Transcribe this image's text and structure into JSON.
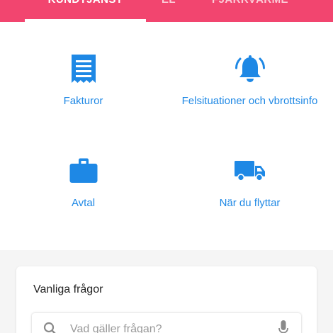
{
  "tabs": [
    {
      "label": "KUNDTJÄNST",
      "active": true
    },
    {
      "label": "EL",
      "active": false
    },
    {
      "label": "FJÄRRVÄRME",
      "active": false
    }
  ],
  "tiles": [
    {
      "label": "Fakturor",
      "icon": "receipt-icon"
    },
    {
      "label": "Felsituationer och vbrottsinfo",
      "icon": "bell-icon"
    },
    {
      "label": "Avtal",
      "icon": "briefcase-icon"
    },
    {
      "label": "När du flyttar",
      "icon": "truck-icon"
    }
  ],
  "faq": {
    "title": "Vanliga frågor",
    "search_placeholder": "Vad gäller frågan?",
    "search_value": ""
  },
  "colors": {
    "tabbar": "#f2456f",
    "accent": "#1e88e5"
  }
}
